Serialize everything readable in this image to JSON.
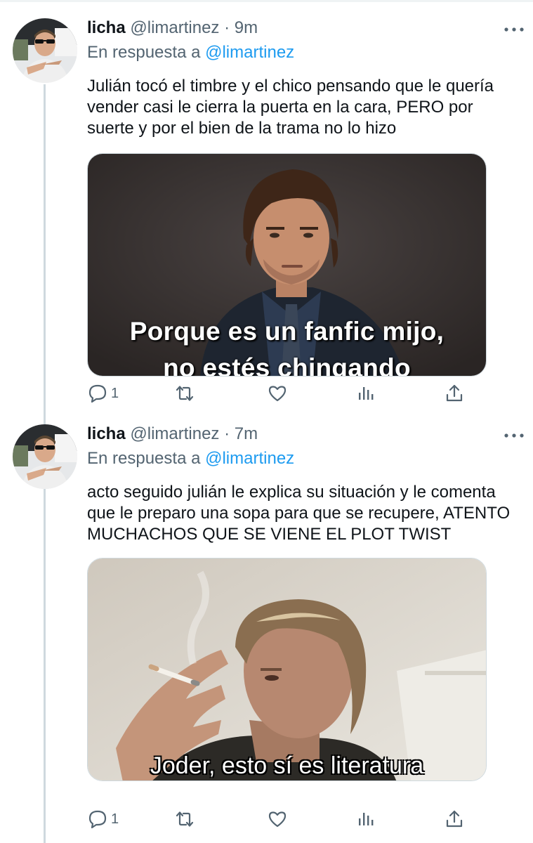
{
  "tweets": [
    {
      "author": "licha",
      "handle": "@limartinez",
      "separator": "·",
      "time": "9m",
      "reply_prefix": "En respuesta a",
      "reply_handle": "@limartinez",
      "text": "Julián tocó el timbre y el chico pensando que le quería vender casi le cierra la puerta en la cara, PERO por suerte y por el bien de la trama no lo hizo",
      "media_caption_line1": "Porque es un fanfic mijo,",
      "media_caption_line2": "no estés chingando",
      "reply_count": "1"
    },
    {
      "author": "licha",
      "handle": "@limartinez",
      "separator": "·",
      "time": "7m",
      "reply_prefix": "En respuesta a",
      "reply_handle": "@limartinez",
      "text": "acto seguido julián le explica su situación y le comenta que le preparo una sopa para que se recupere, ATENTO MUCHACHOS QUE SE VIENE EL PLOT TWIST",
      "media_caption": "Joder, esto sí es literatura",
      "reply_count": "1"
    }
  ],
  "icons": {
    "more": "more-horizontal-icon",
    "reply": "reply-bubble-icon",
    "retweet": "retweet-icon",
    "like": "heart-icon",
    "views": "analytics-bars-icon",
    "share": "share-upload-icon"
  },
  "colors": {
    "accent": "#1d9bf0",
    "secondary_text": "#536471",
    "thread_line": "#cfd9de"
  }
}
